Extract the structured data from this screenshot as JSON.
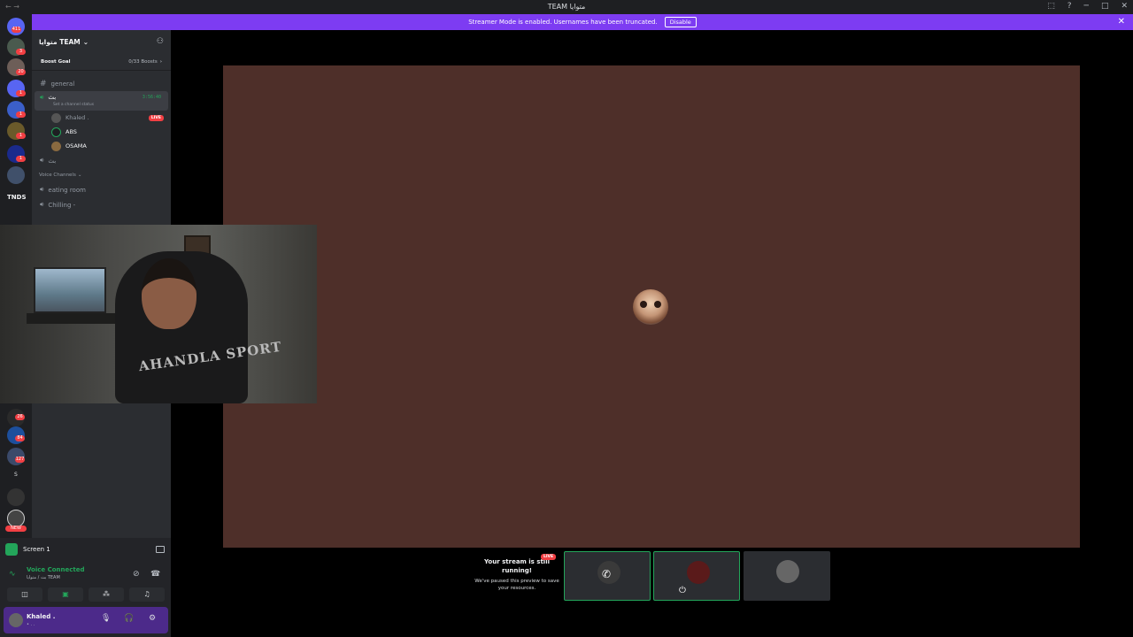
{
  "window": {
    "title": "TEAM متوايا",
    "back": "←",
    "forward": "→",
    "controls": [
      "⬚",
      "?",
      "─",
      "□",
      "✕"
    ]
  },
  "banner": {
    "text": "Streamer Mode is enabled. Usernames have been truncated.",
    "disable_label": "Disable",
    "close": "✕"
  },
  "rail": {
    "badges": [
      "411",
      "3",
      "20",
      "1",
      "1",
      "1",
      "1"
    ],
    "label_tnds": "TNDS",
    "label_s": "S",
    "badges_lower": [
      "26",
      "84",
      "127"
    ],
    "new_label": "NEW"
  },
  "server": {
    "name": "متوايا TEAM",
    "boost_label": "Boost Goal",
    "boost_count": "0/33 Boosts",
    "boost_chevron": "›"
  },
  "channels": {
    "general": "general",
    "active_voice": "بث",
    "active_sub": "Set a channel status",
    "active_timer": "3:56:40",
    "users": [
      {
        "name": "Khaled .",
        "live": "LIVE"
      },
      {
        "name": "ABS"
      },
      {
        "name": "OSAMA"
      }
    ],
    "second_voice": "بث",
    "category": "Voice Channels",
    "eating_room": "eating room",
    "chilling": "Chilling -"
  },
  "webcam": {
    "shirt_text": "AHANDLA SPORT"
  },
  "panel": {
    "screen_label": "Screen 1",
    "voice_status": "Voice Connected",
    "voice_channel": "بث / متوايا TEAM",
    "user_name": "Khaled .",
    "user_status": "• . .",
    "controls": {
      "mic": "🎙",
      "headset": "🎧",
      "settings": "⚙",
      "noise": "⊘",
      "disconnect": "☎",
      "cam": "◫",
      "share": "▣",
      "activity": "⁂",
      "soundboard": "♫"
    }
  },
  "preview": {
    "heading": "Your stream is still running!",
    "body": "We've paused this preview to save your resources.",
    "live_label": "LIVE"
  },
  "colors": {
    "accent": "#7d3cf2",
    "stream_bg": "#4e2f29",
    "voice_green": "#23a55a",
    "live_red": "#f23f43"
  }
}
